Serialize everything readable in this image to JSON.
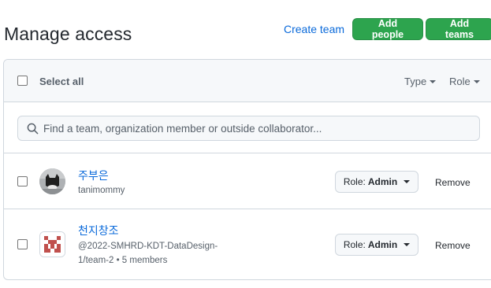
{
  "page": {
    "title": "Manage access",
    "create_team_label": "Create team",
    "add_people_label": "Add people",
    "add_teams_label": "Add teams"
  },
  "colors": {
    "accent_link": "#0969da",
    "primary_button": "#2da44e",
    "border": "#d0d7de",
    "header_bg": "#f6f8fa"
  },
  "list_header": {
    "select_all_label": "Select all",
    "filters": [
      {
        "label": "Type"
      },
      {
        "label": "Role"
      }
    ]
  },
  "search": {
    "placeholder": "Find a team, organization member or outside collaborator...",
    "icon": "search-icon"
  },
  "rows": [
    {
      "kind": "user",
      "name": "주부은",
      "subtitle_line1": "tanimommy",
      "subtitle_line2": "",
      "role_prefix": "Role:",
      "role_value": "Admin",
      "remove_label": "Remove",
      "avatar_icon": "user-avatar"
    },
    {
      "kind": "team",
      "name": "천지창조",
      "subtitle_line1": "@2022-SMHRD-KDT-DataDesign-",
      "subtitle_line2": "1/team-2 • 5 members",
      "role_prefix": "Role:",
      "role_value": "Admin",
      "remove_label": "Remove",
      "avatar_icon": "team-identicon"
    }
  ]
}
